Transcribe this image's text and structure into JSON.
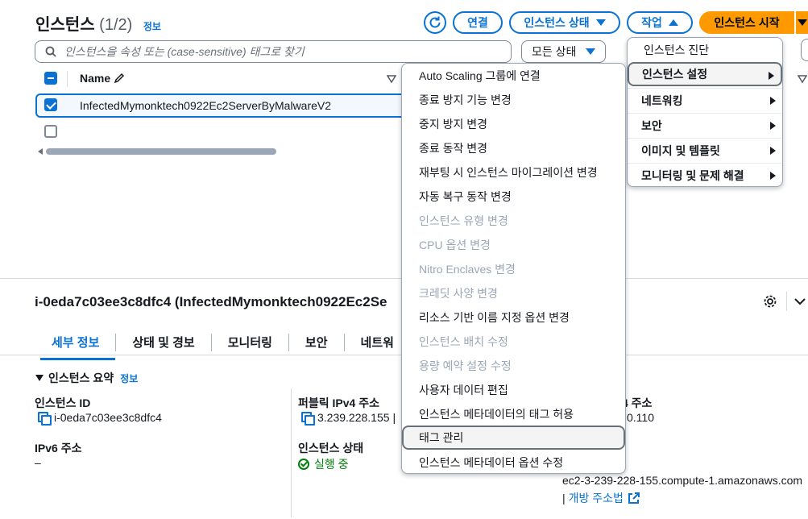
{
  "header": {
    "title": "인스턴스",
    "count": "(1/2)",
    "info": "정보"
  },
  "toolbar": {
    "connect": "연결",
    "instance_state": "인스턴스 상태",
    "actions": "작업",
    "launch": "인스턴스 시작"
  },
  "search": {
    "placeholder": "인스턴스을 속성 또는 (case-sensitive) 태그로 찾기"
  },
  "filter": {
    "selected": "모든 상태"
  },
  "table": {
    "col_name": "Name",
    "rows": [
      {
        "name": "InfectedMymonktech0922Ec2ServerByMalwareV2",
        "checked": true
      },
      {
        "name": "",
        "checked": false
      }
    ]
  },
  "details": {
    "title": "i-0eda7c03ee3c8dfc4 (InfectedMymonktech0922Ec2Se",
    "tabs": [
      "세부 정보",
      "상태 및 경보",
      "모니터링",
      "보안",
      "네트워"
    ],
    "section_title": "인스턴스 요약",
    "section_info": "정보",
    "instance_id_label": "인스턴스 ID",
    "instance_id": "i-0eda7c03ee3c8dfc4",
    "public_ipv4_label": "퍼블릭 IPv4 주소",
    "public_ipv4": "3.239.228.155",
    "ipv6_label": "IPv6 주소",
    "ipv6": "–",
    "state_label": "인스턴스 상태",
    "state": "실행 중",
    "private_ip_label_frag": "4 주소",
    "private_ip_frag": "0.110",
    "dns": "ec2-3-239-228-155.compute-1.amazonaws.com",
    "open_address": "개방 주소법"
  },
  "actions_menu": [
    {
      "label": "인스턴스 진단",
      "submenu": false
    },
    {
      "label": "인스턴스 설정",
      "submenu": true,
      "active": true
    },
    {
      "label": "네트워킹",
      "submenu": true
    },
    {
      "label": "보안",
      "submenu": true
    },
    {
      "label": "이미지 및 템플릿",
      "submenu": true
    },
    {
      "label": "모니터링 및 문제 해결",
      "submenu": true
    }
  ],
  "settings_menu": [
    {
      "label": "Auto Scaling 그룹에 연결",
      "disabled": false
    },
    {
      "label": "종료 방지 기능 변경",
      "disabled": false
    },
    {
      "label": "중지 방지 변경",
      "disabled": false
    },
    {
      "label": "종료 동작 변경",
      "disabled": false
    },
    {
      "label": "재부팅 시 인스턴스 마이그레이션 변경",
      "disabled": false
    },
    {
      "label": "자동 복구 동작 변경",
      "disabled": false
    },
    {
      "label": "인스턴스 유형 변경",
      "disabled": true
    },
    {
      "label": "CPU 옵션 변경",
      "disabled": true
    },
    {
      "label": "Nitro Enclaves 변경",
      "disabled": true
    },
    {
      "label": "크레딧 사양 변경",
      "disabled": true
    },
    {
      "label": "리소스 기반 이름 지정 옵션 변경",
      "disabled": false
    },
    {
      "label": "인스턴스 배치 수정",
      "disabled": true
    },
    {
      "label": "용량 예약 설정 수정",
      "disabled": true
    },
    {
      "label": "사용자 데이터 편집",
      "disabled": false
    },
    {
      "label": "인스턴스 메타데이터의 태그 허용",
      "disabled": false
    },
    {
      "label": "태그 관리",
      "disabled": false,
      "hover": true
    },
    {
      "label": "인스턴스 메타데이터 옵션 수정",
      "disabled": false
    }
  ],
  "colors": {
    "accent": "#0972d3",
    "primary": "#ff9900",
    "success": "#037f0c",
    "disabled": "#9ba7b6"
  }
}
